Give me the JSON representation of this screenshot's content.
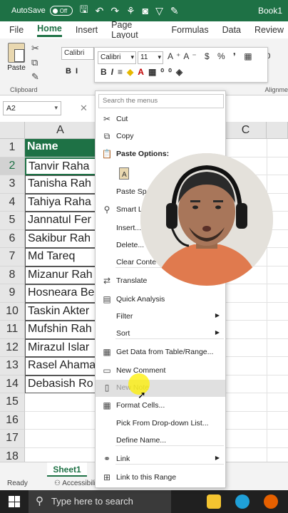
{
  "titlebar": {
    "autosave_label": "AutoSave",
    "toggle_state": "Off",
    "book_title": "Book1"
  },
  "menu_tabs": [
    "File",
    "Home",
    "Insert",
    "Page Layout",
    "Formulas",
    "Data",
    "Review"
  ],
  "ribbon": {
    "paste_label": "Paste",
    "clipboard_label": "Clipboard",
    "font_name": "Calibri",
    "alignment_label": "Alignme"
  },
  "mini_toolbar": {
    "font": "Calibri",
    "size": "11"
  },
  "namebox": {
    "value": "A2"
  },
  "columns": [
    "A",
    "C"
  ],
  "rows": [
    "1",
    "2",
    "3",
    "4",
    "5",
    "6",
    "7",
    "8",
    "9",
    "10",
    "11",
    "12",
    "13",
    "14",
    "15",
    "16",
    "17",
    "18"
  ],
  "cells": [
    "Name",
    "Tanvir Raha",
    "Tanisha Rah",
    "Tahiya Raha",
    "Jannatul Fer",
    "Sakibur Rah",
    "Md Tareq",
    "Mizanur Rah",
    "Hosneara Be",
    "Taskin Akter",
    "Mufshin Rah",
    "Mirazul Islar",
    "Rasel Ahama",
    "Debasish Ro"
  ],
  "context_menu": {
    "search_placeholder": "Search the menus",
    "items": [
      "Cut",
      "Copy",
      "Paste Options:",
      "Paste Spe",
      "Smart Lo",
      "Insert...",
      "Delete...",
      "Clear Conte",
      "Translate",
      "Quick Analysis",
      "Filter",
      "Sort",
      "Get Data from Table/Range...",
      "New Comment",
      "New Note",
      "Format Cells...",
      "Pick From Drop-down List...",
      "Define Name...",
      "Link",
      "Link to this Range"
    ]
  },
  "sheet_tab": "Sheet1",
  "status": {
    "ready": "Ready",
    "accessibility": "Accessibili"
  },
  "taskbar": {
    "search_placeholder": "Type here to search"
  },
  "colors": {
    "excel_green": "#1e7145",
    "highlight_yellow": "#fff000"
  }
}
